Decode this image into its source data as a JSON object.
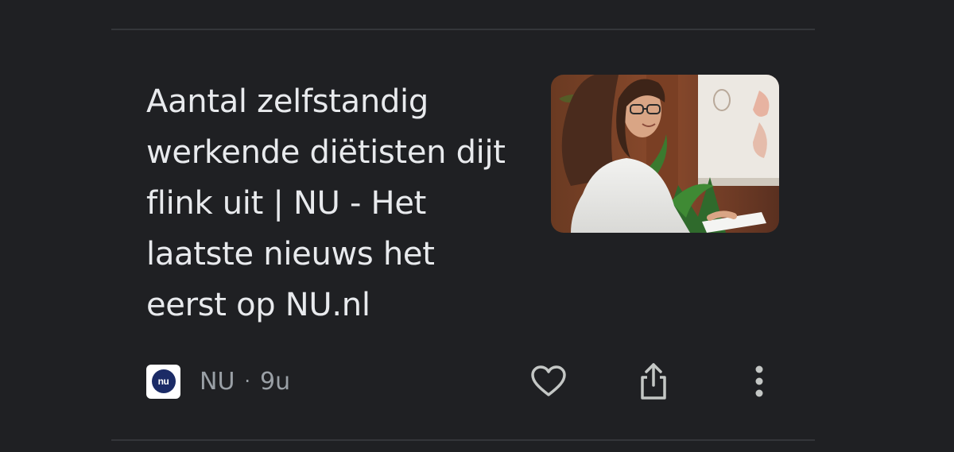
{
  "article": {
    "headline": "Aantal zelfstandig werkende diëtisten dijt flink uit | NU - Het laatste nieuws het eerst op NU.nl",
    "source_logo_text": "nu",
    "source_name": "NU",
    "separator": "·",
    "age": "9u",
    "icons": {
      "like": "heart-icon",
      "share": "share-icon",
      "more": "more-vert-icon"
    }
  },
  "colors": {
    "background": "#1f2023",
    "headline_text": "#e8eaed",
    "meta_text": "#9aa0a6",
    "icon": "#c4c7c5",
    "divider": "#34363a"
  }
}
